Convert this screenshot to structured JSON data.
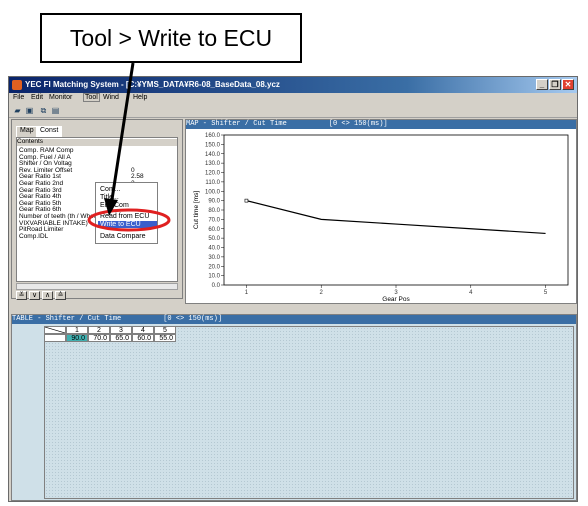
{
  "callout": {
    "text": "Tool > Write to ECU"
  },
  "window": {
    "title": "YEC FI Matching System - [C:¥YMS_DATA¥R6-08_BaseData_08.ycz",
    "controls": {
      "minimize": "_",
      "restore": "❐",
      "close": "✕"
    }
  },
  "menu": {
    "file": "File",
    "edit": "Edit",
    "monitor": "Monitor",
    "tool": "Tool",
    "window": "Wind",
    "help": "Help"
  },
  "tool_menu": {
    "items": [
      "Com...",
      "Title...",
      "Edit Com",
      "Read from ECU",
      "Write to ECU",
      "Data Compare"
    ],
    "highlighted": "Write to ECU"
  },
  "left_panel": {
    "tabs": [
      "Map",
      "Const"
    ],
    "header": "Contents",
    "rows": [
      {
        "label": "Comp. RAM Comp",
        "value": ""
      },
      {
        "label": "Comp. Fuel / All A",
        "value": ""
      },
      {
        "label": "Shifter / On Voltag",
        "value": ""
      },
      {
        "label": "Rev. Limiter Offset",
        "value": "0"
      },
      {
        "label": "Gear Ratio 1st",
        "value": "2.58"
      },
      {
        "label": "Gear Ratio 2nd",
        "value": "2"
      },
      {
        "label": "Gear Ratio 3rd",
        "value": "1.67"
      },
      {
        "label": "Gear Ratio 4th",
        "value": "1.44"
      },
      {
        "label": "Gear Ratio 5th",
        "value": "1.29"
      },
      {
        "label": "Gear Ratio 6th",
        "value": "1.15"
      },
      {
        "label": "Number of teeth (th / Wheel)",
        "value": "23"
      },
      {
        "label": "VIXVARIABLE INTAKE)",
        "value": "12700"
      },
      {
        "label": "PitRoad Limiter",
        "value": "17000"
      },
      {
        "label": "Comp.IDL",
        "value": "0.00"
      }
    ]
  },
  "map_panel": {
    "title": "MAP - Shifter / Cut Time          [0 <> 150(ms)]"
  },
  "table_panel": {
    "title": "TABLE - Shifter / Cut Time          [0 <> 150(ms)]",
    "columns": [
      "1",
      "2",
      "3",
      "4",
      "5"
    ],
    "values": [
      "90.0",
      "70.0",
      "65.0",
      "60.0",
      "55.0"
    ]
  },
  "chart_data": {
    "type": "line",
    "xlabel": "Gear Pos",
    "ylabel": "Cut time [ms]",
    "x": [
      1,
      2,
      3,
      4,
      5
    ],
    "y_ticks": [
      "0.0",
      "10.0",
      "20.0",
      "30.0",
      "40.0",
      "50.0",
      "60.0",
      "70.0",
      "80.0",
      "90.0",
      "100.0",
      "110.0",
      "120.0",
      "130.0",
      "140.0",
      "150.0",
      "160.0"
    ],
    "x_ticks": [
      "1",
      "2",
      "3",
      "4",
      "5"
    ],
    "ylim": [
      0,
      160
    ],
    "series": [
      {
        "values": [
          90,
          70,
          65,
          60,
          55
        ]
      }
    ],
    "colors": {
      "line": "#000000"
    }
  },
  "colors": {
    "title_bar": "#0a246a",
    "panel_title": "#3a6ea5",
    "highlight": "#3a5fcd",
    "selected_cell": "#40b0b0",
    "callout_ring": "#e02020"
  }
}
